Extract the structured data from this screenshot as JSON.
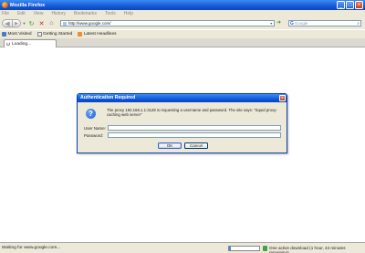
{
  "window": {
    "title": "Mozilla Firefox"
  },
  "menu": [
    "File",
    "Edit",
    "View",
    "History",
    "Bookmarks",
    "Tools",
    "Help"
  ],
  "nav": {
    "url": "http://www.google.com/",
    "search_placeholder": "Google"
  },
  "bookmarks": [
    {
      "label": "Most Visited",
      "icon": "most-visited-icon"
    },
    {
      "label": "Getting Started",
      "icon": "page-icon"
    },
    {
      "label": "Latest Headlines",
      "icon": "rss-icon"
    }
  ],
  "tab": {
    "label": "Loading..."
  },
  "dialog": {
    "title": "Authentication Required",
    "message": "The proxy 192.168.1.1:3128 is requesting a username and password. The site says: \"Squid proxy-caching web server\"",
    "user_label": "User Name:",
    "password_label": "Password:",
    "ok_label": "OK",
    "cancel_label": "Cancel"
  },
  "status": {
    "text": "Waiting for www.google.com...",
    "download_progress": 0.05,
    "download_text": "One active download (1 hour, 42 minutes remaining)"
  }
}
